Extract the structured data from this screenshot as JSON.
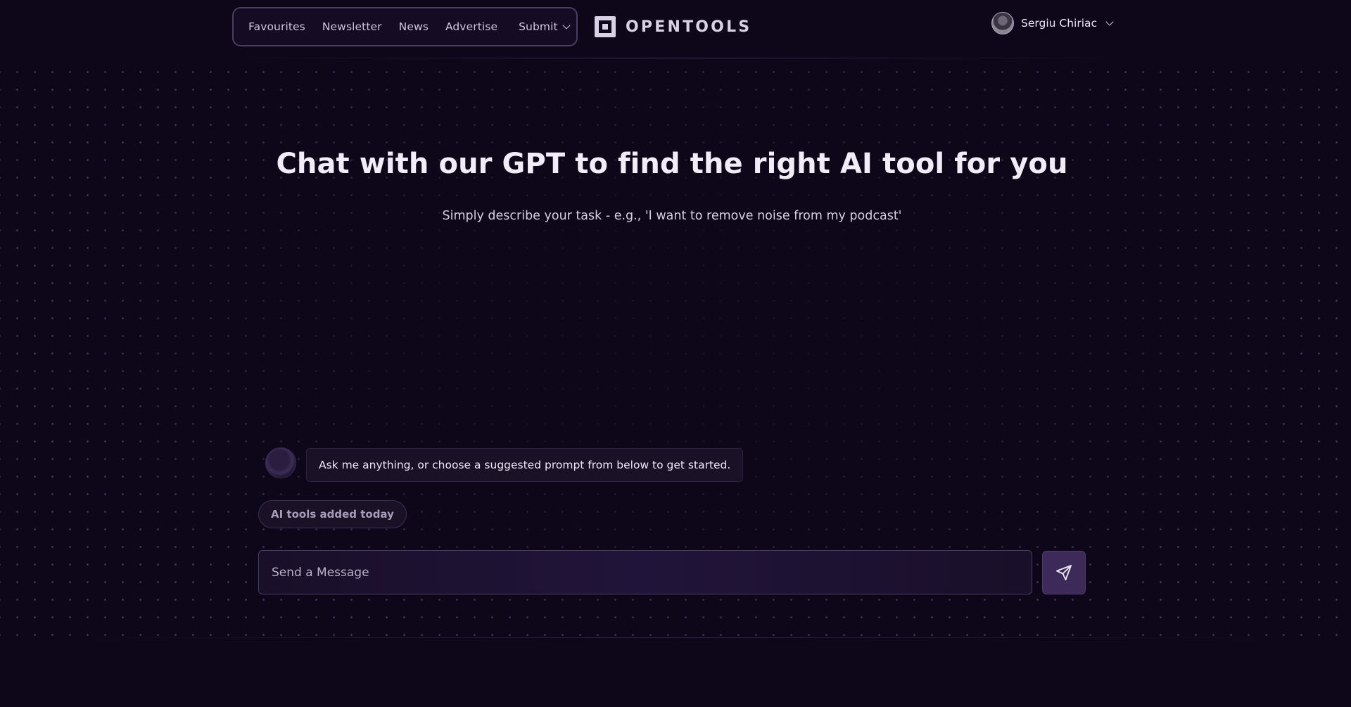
{
  "nav": {
    "items": [
      {
        "label": "Favourites"
      },
      {
        "label": "Newsletter"
      },
      {
        "label": "News"
      },
      {
        "label": "Advertise"
      }
    ],
    "submit_label": "Submit"
  },
  "brand": {
    "name": "OPENTOOLS",
    "icon": "opentools-logo-icon"
  },
  "user": {
    "name": "Sergiu Chiriac",
    "icon": "avatar"
  },
  "hero": {
    "title": "Chat with our GPT to find the right AI tool for you",
    "subtitle": "Simply describe your task - e.g., 'I want to remove noise from my podcast'"
  },
  "chat": {
    "bot_message": "Ask me anything, or choose a suggested prompt from below to get started.",
    "suggested_prompts": [
      {
        "label": "AI tools added today"
      }
    ],
    "input_placeholder": "Send a Message",
    "send_icon": "send-icon"
  },
  "colors": {
    "background": "#0e0619",
    "nav_border": "#4a3d63",
    "accent": "#3d2a58",
    "text": "#f1ecf7"
  }
}
